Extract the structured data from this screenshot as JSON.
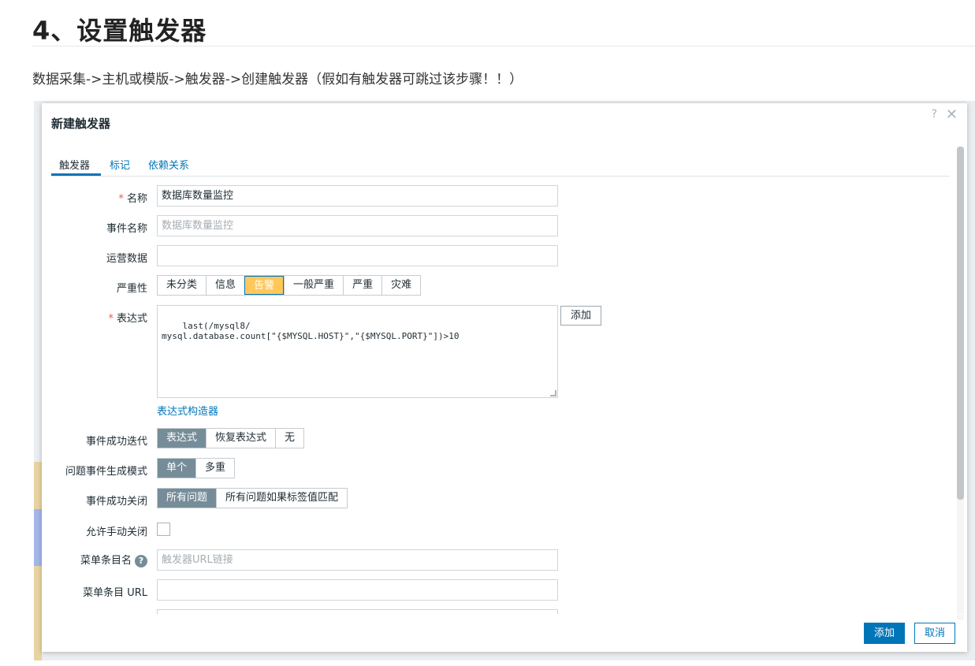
{
  "article": {
    "heading": "4、设置触发器",
    "intro": "数据采集->主机或模版->触发器->创建触发器（假如有触发器可跳过该步骤！！）"
  },
  "dialog": {
    "title": "新建触发器",
    "help": "?",
    "close": "✕",
    "tabs": [
      {
        "label": "触发器"
      },
      {
        "label": "标记"
      },
      {
        "label": "依赖关系"
      }
    ],
    "fields": {
      "name": {
        "label": "名称",
        "required_mark": "*",
        "value": "数据库数量监控"
      },
      "event_name": {
        "label": "事件名称",
        "placeholder": "数据库数量监控"
      },
      "opdata": {
        "label": "运营数据",
        "value": ""
      },
      "severity": {
        "label": "严重性",
        "options": [
          "未分类",
          "信息",
          "告警",
          "一般严重",
          "严重",
          "灾难"
        ],
        "selected": "告警"
      },
      "expression": {
        "label": "表达式",
        "required_mark": "*",
        "value": "last(/mysql8/\nmysql.database.count[\"{$MYSQL.HOST}\",\"{$MYSQL.PORT}\"])>10",
        "add_label": "添加",
        "builder_link": "表达式构造器"
      },
      "ok_event_gen": {
        "label": "事件成功迭代",
        "options": [
          "表达式",
          "恢复表达式",
          "无"
        ],
        "selected": "表达式"
      },
      "problem_mode": {
        "label": "问题事件生成模式",
        "options": [
          "单个",
          "多重"
        ],
        "selected": "单个"
      },
      "ok_close": {
        "label": "事件成功关闭",
        "options": [
          "所有问题",
          "所有问题如果标签值匹配"
        ],
        "selected": "所有问题"
      },
      "manual_close": {
        "label": "允许手动关闭"
      },
      "menu_name": {
        "label": "菜单条目名",
        "help": "?",
        "placeholder": "触发器URL链接"
      },
      "menu_url": {
        "label": "菜单条目 URL",
        "value": ""
      }
    },
    "footer": {
      "add_label": "添加",
      "cancel_label": "取消"
    }
  },
  "colors": {
    "accent": "#0275b8",
    "warning": "#ffc859",
    "selected_grey": "#768d99",
    "required": "#e45959"
  }
}
